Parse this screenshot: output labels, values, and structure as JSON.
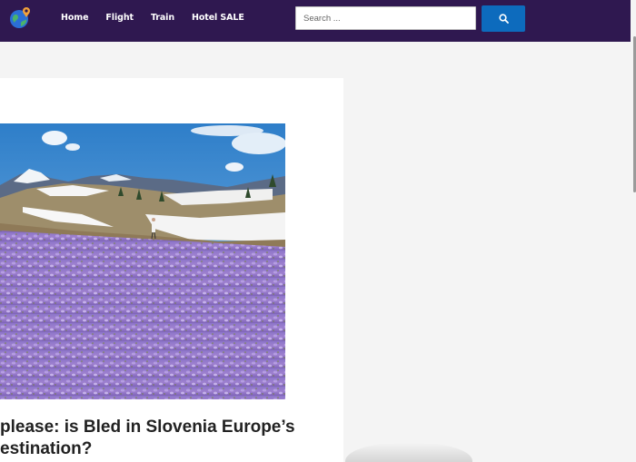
{
  "header": {
    "logo_icon": "globe-pin-icon",
    "nav": [
      "Home",
      "Flight",
      "Train",
      "Hotel SALE"
    ],
    "search": {
      "placeholder": "Search ...",
      "button_icon": "search-icon"
    },
    "background": "#2f1850",
    "accent": "#0d6bbd"
  },
  "post": {
    "image_alt": "crocus-meadow-photo",
    "title_line1": "please: is Bled in Slovenia Europe’s",
    "title_line2": "estination?"
  }
}
